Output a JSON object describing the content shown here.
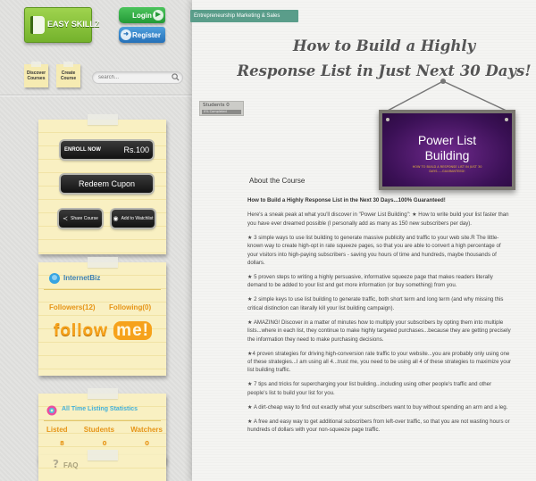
{
  "header": {
    "logo_text": "EASY SKILLZ",
    "login_label": "Login",
    "register_label": "Register"
  },
  "nav": {
    "discover_label": "Discover Courses",
    "create_label": "Create Course",
    "search_placeholder": "search..."
  },
  "actions": {
    "enroll_label": "ENROLL NOW",
    "price": "Rs.100",
    "redeem_label": "Redeem Cupon",
    "share_label": "Share Course",
    "wishlist_label": "Add to Watchlist"
  },
  "instructor": {
    "name": "InternetBiz",
    "followers": "Followers(12)",
    "following": "Following(0)",
    "follow_me_a": "follow",
    "follow_me_b": "me!"
  },
  "stats": {
    "title": "All Time Listing Statistics",
    "labels": [
      "Listed",
      "Students",
      "Watchers"
    ],
    "values": [
      "8",
      "0",
      "0"
    ]
  },
  "faq": {
    "title": "FAQ"
  },
  "course": {
    "category": "Entrepreneurship Marketing & Sales",
    "title_line1": "How to Build a Highly",
    "title_line2": "Response List in Just Next 30 Days!",
    "students_label": "Students 0",
    "students_bar_text": "0% Completed",
    "sign_title_1": "Power List",
    "sign_title_2": "Building",
    "sign_subtitle": "How to build a response list in just 30 days.....Guaranteed!",
    "about_heading": "About the Course"
  },
  "about": {
    "lead": "How to Build a Highly Response List in the Next 30 Days...100% Guaranteed!",
    "paragraphs": [
      "Here's a sneak peak at what you'll discover in \"Power List Building\": ★ How to write build your list faster than you have ever dreamed possible (I personally add as many as 150 new subscribers per day).",
      "★ 3 simple ways to use list building to generate massive publicity and traffic to your web site.R The little-known way to create high-opt in rate squeeze pages, so that you are able to convert a high percentage of your visitors into high-paying subscribers - saving you hours of time and hundreds, maybe thousands of dollars.",
      "★ 5 proven steps to writing a highly persuasive, informative squeeze page that makes readers literally demand to be added to your list and get more information (or buy something) from you.",
      "★ 2 simple keys to use list building to generate traffic, both short term and long term (and why missing this critical distinction can literally kill your list building campaign).",
      "★ AMAZING! Discover in a matter of minutes how to multiply your subscribers by opting them into multiple lists...where in each list, they continue to make highly targeted purchases...because they are getting precisely the information they need to make purchasing decisions.",
      "★4 proven strategies for driving high-conversion rate traffic to your website...you are probably only using one of these strategies...I am using all 4...trust me, you need to be using all 4 of these strategies to maximize your list building traffic.",
      "★ 7 tips and tricks for supercharging your list building...including using other people's traffic and other people's list to build your list for you.",
      "★ A dirt-cheap way to find out exactly what your subscribers want to buy without spending an arm and a leg.",
      "★ A free and easy way to get additional subscribers from left-over traffic, so that you are not wasting hours or hundreds of dollars with your non-squeeze page traffic."
    ]
  }
}
